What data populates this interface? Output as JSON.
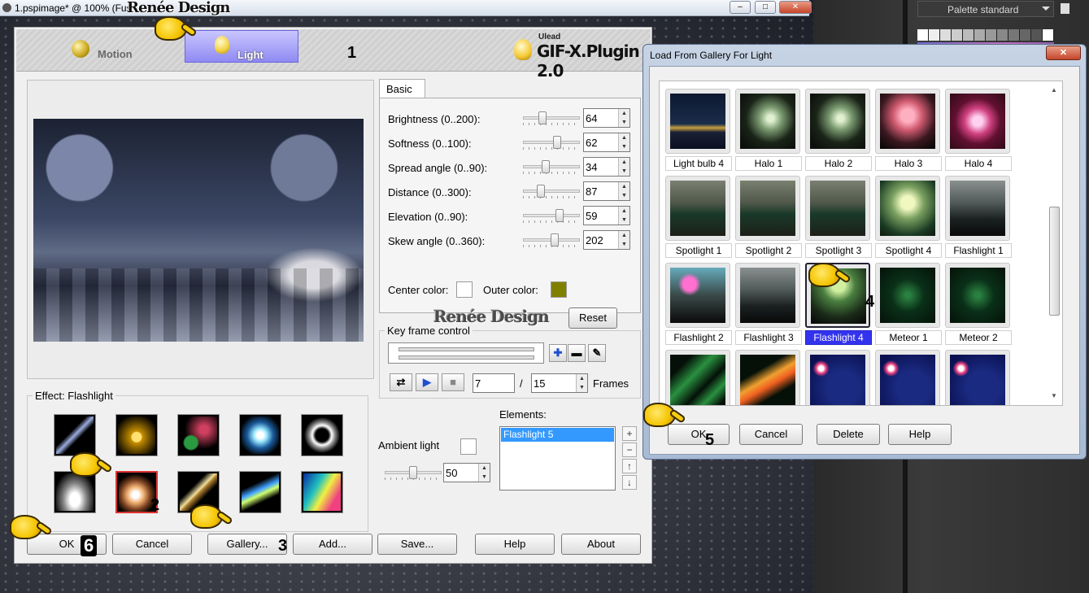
{
  "host": {
    "title": "1.pspimage* @ 100% (Fus",
    "watermark": "Renée Design",
    "palette_label": "Palette standard",
    "win_buttons": [
      "–",
      "□",
      "✕"
    ]
  },
  "plugin": {
    "modes": [
      {
        "label": "Motion",
        "icon": "ball-icon"
      },
      {
        "label": "Light",
        "icon": "bulb-icon"
      }
    ],
    "brand_small": "Ulead",
    "brand_big": "GIF-X.Plugin 2.0",
    "tab": "Basic",
    "params": [
      {
        "label": "Brightness (0..200):",
        "value": "64",
        "level": 0.32
      },
      {
        "label": "Softness (0..100):",
        "value": "62",
        "level": 0.62
      },
      {
        "label": "Spread angle (0..90):",
        "value": "34",
        "level": 0.38
      },
      {
        "label": "Distance (0..300):",
        "value": "87",
        "level": 0.29
      },
      {
        "label": "Elevation (0..90):",
        "value": "59",
        "level": 0.66
      },
      {
        "label": "Skew angle (0..360):",
        "value": "202",
        "level": 0.56
      }
    ],
    "center_color_label": "Center color:",
    "center_color": "#ffffff",
    "outer_color_label": "Outer color:",
    "outer_color": "#808000",
    "logo": "Renée Design",
    "reset": "Reset",
    "keyframe": {
      "title": "Key frame control",
      "current_frame": "7",
      "separator": "/",
      "total_frames": "15",
      "frames_label": "Frames"
    },
    "effect_title": "Effect: Flashlight",
    "effect_thumbs": [
      "lightning",
      "fireworks",
      "lens-flare",
      "star-burst",
      "ring-glow",
      "spotlight-beam",
      "flashlight-orb",
      "meteor-streak",
      "comet-beam",
      "rainbow-wave"
    ],
    "selected_effect": 6,
    "elements_label": "Elements:",
    "elements": [
      "Flashlight 5"
    ],
    "element_buttons": [
      "+",
      "−",
      "↑",
      "↓"
    ],
    "ambient_label": "Ambient light",
    "ambient_color": "#ffffff",
    "ambient_value": "50",
    "ambient_level": 0.5,
    "buttons": [
      "OK",
      "Cancel",
      "Gallery...",
      "Add...",
      "Save...",
      "Help",
      "About"
    ]
  },
  "gallery": {
    "title": "Load From Gallery For Light",
    "close": "✕",
    "items": [
      {
        "label": "Light bulb 4",
        "style": "night-city"
      },
      {
        "label": "Halo 1",
        "style": "tree-halo"
      },
      {
        "label": "Halo 2",
        "style": "tree-halo"
      },
      {
        "label": "Halo 3",
        "style": "tree-pink"
      },
      {
        "label": "Halo 4",
        "style": "pink-sphere"
      },
      {
        "label": "Spotlight 1",
        "style": "statue"
      },
      {
        "label": "Spotlight 2",
        "style": "statue"
      },
      {
        "label": "Spotlight 3",
        "style": "statue"
      },
      {
        "label": "Spotlight 4",
        "style": "statue-bright"
      },
      {
        "label": "Flashlight 1",
        "style": "monument"
      },
      {
        "label": "Flashlight 2",
        "style": "monument-color"
      },
      {
        "label": "Flashlight 3",
        "style": "monument"
      },
      {
        "label": "Flashlight 4",
        "style": "monument-green"
      },
      {
        "label": "Meteor 1",
        "style": "green-stars"
      },
      {
        "label": "Meteor 2",
        "style": "green-stars"
      },
      {
        "label": "",
        "style": "green-streaks"
      },
      {
        "label": "",
        "style": "orange-comet"
      },
      {
        "label": "",
        "style": "blue-comet"
      },
      {
        "label": "",
        "style": "blue-comet"
      },
      {
        "label": "",
        "style": "blue-comet"
      }
    ],
    "selected": 12,
    "buttons": [
      "OK",
      "Cancel",
      "Delete",
      "Help"
    ]
  },
  "annotations": [
    "1",
    "2",
    "3",
    "4",
    "5",
    "6"
  ]
}
